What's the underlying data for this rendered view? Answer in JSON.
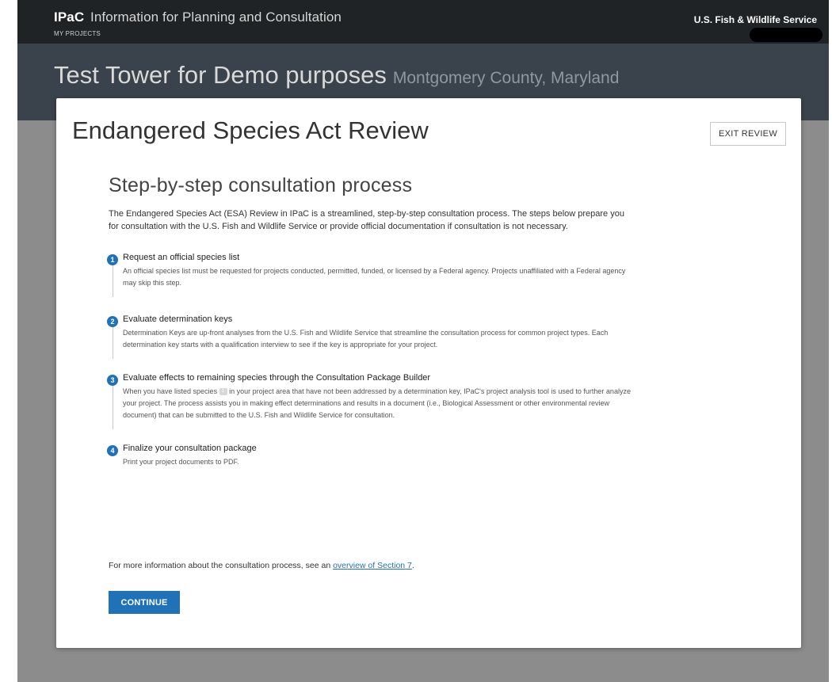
{
  "header": {
    "brand": "IPaC",
    "tagline": "Information for Planning and Consultation",
    "my_projects": "MY PROJECTS",
    "agency": "U.S. Fish & Wildlife Service"
  },
  "project": {
    "title": "Test Tower for Demo purposes",
    "location": "Montgomery County, Maryland"
  },
  "modal": {
    "title": "Endangered Species Act Review",
    "exit_label": "EXIT REVIEW",
    "heading": "Step-by-step consultation process",
    "intro": "The Endangered Species Act (ESA) Review in IPaC is a streamlined, step-by-step consultation process. The steps below prepare you for consultation with the U.S. Fish and Wildlife Service or provide official documentation if consultation is not necessary.",
    "steps": [
      {
        "number": "1",
        "title": "Request an official species list",
        "desc": "An official species list must be requested for projects conducted, permitted, funded, or licensed by a Federal agency. Projects unaffiliated with a Federal agency may skip this step."
      },
      {
        "number": "2",
        "title": "Evaluate determination keys",
        "desc": "Determination Keys are up-front analyses from the U.S. Fish and Wildlife Service that streamline the consultation process for common project types. Each determination key starts with a qualification interview to see if the key is appropriate for your project."
      },
      {
        "number": "3",
        "title": "Evaluate effects to remaining species through the Consultation Package Builder",
        "desc_a": "When you have listed species",
        "badge": "1",
        "desc_b": "in your project area that have not been addressed by a determination key, IPaC's project analysis tool is used to further analyze your project. The process assists you in making effect determinations and results in a document (i.e., Biological Assessment or other environmental review document) that can be submitted to the U.S. Fish and Wildlife Service for consultation."
      },
      {
        "number": "4",
        "title": "Finalize your consultation package",
        "desc": "Print your project documents to PDF."
      }
    ],
    "more_info_prefix": "For more information about the consultation process, see an",
    "more_info_link": "overview of Section 7",
    "more_info_suffix": ".",
    "continue_label": "CONTINUE"
  },
  "colors": {
    "topbar": "#1f2326",
    "titlebar": "#3a434b",
    "backdrop": "#8c8c8c",
    "accent": "#1f71b8"
  }
}
